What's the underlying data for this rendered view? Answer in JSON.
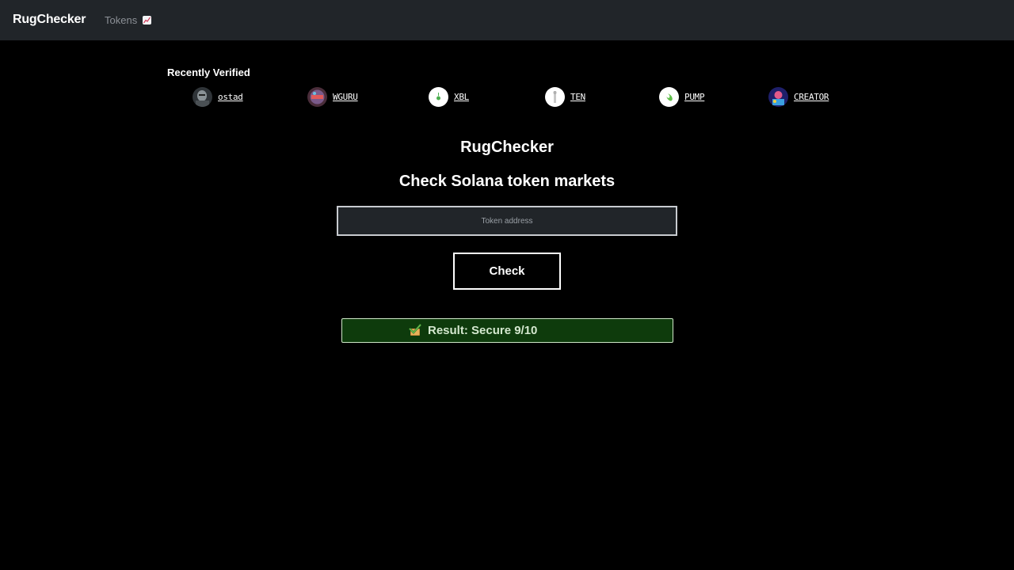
{
  "navbar": {
    "brand": "RugChecker",
    "tokens_link": "Tokens",
    "tokens_icon": "chart-increasing-icon"
  },
  "recently_verified": {
    "title": "Recently Verified",
    "items": [
      {
        "label": "ostad",
        "avatar_color": "#3a3f44"
      },
      {
        "label": "WGURU",
        "avatar_color": "#5a3a4a"
      },
      {
        "label": "XBL",
        "avatar_color": "#ffffff"
      },
      {
        "label": "TEN",
        "avatar_color": "#ffffff"
      },
      {
        "label": "PUMP",
        "avatar_color": "#ffffff"
      },
      {
        "label": "CREATOR",
        "avatar_color": "#2b2f8f"
      }
    ]
  },
  "main": {
    "title": "RugChecker",
    "subtitle": "Check Solana token markets",
    "input_placeholder": "Token address",
    "input_value": "",
    "check_button": "Check"
  },
  "result": {
    "icon": "check-mark-icon",
    "text": "Result: Secure 9/10",
    "background": "#0e3b0c"
  },
  "colors": {
    "navbar_bg": "#212529",
    "page_bg": "#000000"
  }
}
